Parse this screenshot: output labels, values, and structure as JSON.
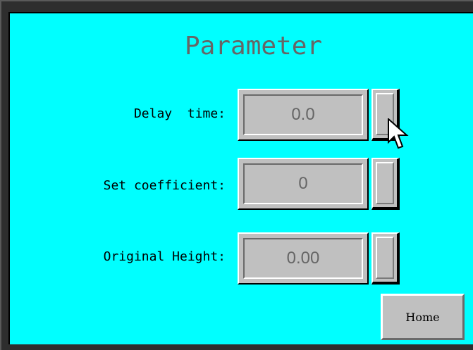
{
  "screen": {
    "title": "Parameter",
    "background_color": "#00ffff"
  },
  "parameters": [
    {
      "label": "Delay  time:",
      "value": "0.0"
    },
    {
      "label": "Set coefficient:",
      "value": "0"
    },
    {
      "label": "Original Height:",
      "value": "0.00"
    }
  ],
  "home_button": {
    "label": "Home"
  },
  "cursor": {
    "icon": "arrow-cursor-icon"
  }
}
